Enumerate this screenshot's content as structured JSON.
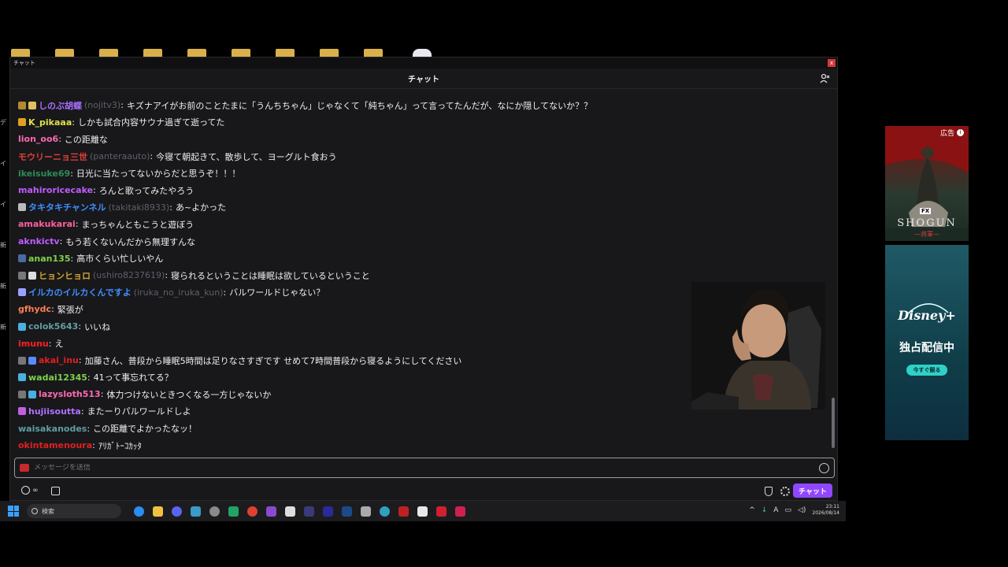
{
  "window": {
    "titlebar_title": "チャット",
    "close_label": "x",
    "header_title": "チャット"
  },
  "desktop_labels": [
    "デ",
    "イ",
    "イ",
    "新",
    "新",
    "新"
  ],
  "messages": [
    {
      "user": "しのぶ胡蝶",
      "login": "(nojitv3)",
      "text": "キズナアイがお前のことたまに「うんちちゃん」じゃなくて「純ちゃん」って言ってたんだが、なにか隠してないか？？",
      "color": "#a970ff",
      "badges": [
        "#b08a30",
        "#e0c060"
      ]
    },
    {
      "user": "K_pikaaa",
      "login": "",
      "text": "しかも試合内容サウナ過ぎて逝ってた",
      "color": "#e0e04a",
      "badges": [
        "#e0a020"
      ]
    },
    {
      "user": "lion_oo6",
      "login": "",
      "text": "この距離な",
      "color": "#ff69b4",
      "badges": []
    },
    {
      "user": "モウリーニョ三世",
      "login": "(panteraauto)",
      "text": "今寝て朝起きて、散歩して、ヨーグルト食おう",
      "color": "#e0403a",
      "badges": []
    },
    {
      "user": "ikeisuke69",
      "login": "",
      "text": "日光に当たってないからだと思うぞ！！！",
      "color": "#2e8b57",
      "badges": []
    },
    {
      "user": "mahiroricecake",
      "login": "",
      "text": "ろんと歌ってみたやろう",
      "color": "#c05cff",
      "badges": []
    },
    {
      "user": "タキタキチャンネル",
      "login": "(takitaki8933)",
      "text": "あ~よかった",
      "color": "#3f8fff",
      "badges": [
        "#bbbbbb"
      ]
    },
    {
      "user": "amakukarai",
      "login": "",
      "text": "まっちゃんともこうと遊ぼう",
      "color": "#ff5fa0",
      "badges": []
    },
    {
      "user": "aknkictv",
      "login": "",
      "text": "もう若くないんだから無理すんな",
      "color": "#c05cff",
      "badges": []
    },
    {
      "user": "anan135",
      "login": "",
      "text": "高市くらい忙しいやん",
      "color": "#7fd04a",
      "badges": [
        "#4a6aa0"
      ]
    },
    {
      "user": "ヒョンヒョロ",
      "login": "(ushiro8237619)",
      "text": "寝られるということは睡眠は欲しているということ",
      "color": "#d0a030",
      "badges": [
        "#777777",
        "#dddddd"
      ]
    },
    {
      "user": "イルカのイルカくんですよ",
      "login": "(iruka_no_iruka_kun)",
      "text": "バルワールドじゃない？",
      "color": "#3f8fff",
      "badges": [
        "#9aa0ff"
      ]
    },
    {
      "user": "gfhydc",
      "login": "",
      "text": "緊張が",
      "color": "#ff7f50",
      "badges": []
    },
    {
      "user": "colok5643",
      "login": "",
      "text": "いいね",
      "color": "#5f9ea0",
      "badges": [
        "#4ab0e0"
      ]
    },
    {
      "user": "imunu",
      "login": "",
      "text": "え",
      "color": "#ff2020",
      "badges": []
    },
    {
      "user": "akai_inu",
      "login": "",
      "text": "加藤さん、普段から睡眠5時間は足りなさすぎです せめて7時間普段から寝るようにしてください",
      "color": "#e02020",
      "badges": [
        "#777777",
        "#5a8aff"
      ]
    },
    {
      "user": "wadai12345",
      "login": "",
      "text": "41って事忘れてる？",
      "color": "#7fd04a",
      "badges": [
        "#4ab0e0"
      ]
    },
    {
      "user": "lazysloth513",
      "login": "",
      "text": "体力つけないときつくなる一方じゃないか",
      "color": "#ff69b4",
      "badges": [
        "#777777",
        "#4ab0e0"
      ]
    },
    {
      "user": "hujiisoutta",
      "login": "",
      "text": "またーりパルワールドしよ",
      "color": "#b070ff",
      "badges": [
        "#c060e0"
      ]
    },
    {
      "user": "waisakanodes",
      "login": "",
      "text": "この距離でよかったなッ！",
      "color": "#5f9ea0",
      "badges": []
    },
    {
      "user": "okintamenoura",
      "login": "",
      "text": "ｱﾘｶﾞﾄｰｺｶｯﾀ",
      "color": "#e02020",
      "badges": []
    }
  ],
  "input": {
    "placeholder": "メッセージを送信"
  },
  "bottom": {
    "points": "∞",
    "chat_button": "チャット"
  },
  "ads": {
    "label": "広告",
    "shogun_fx": "FX",
    "shogun_title": "SHOGUN",
    "shogun_sub": "—将軍—",
    "disney_logo": "Disney+",
    "disney_headline": "独占配信中",
    "disney_cta": "今すぐ観る"
  },
  "taskbar": {
    "search_label": "検索",
    "time": "23:11",
    "date": "2026/08/14",
    "ime": "A"
  }
}
